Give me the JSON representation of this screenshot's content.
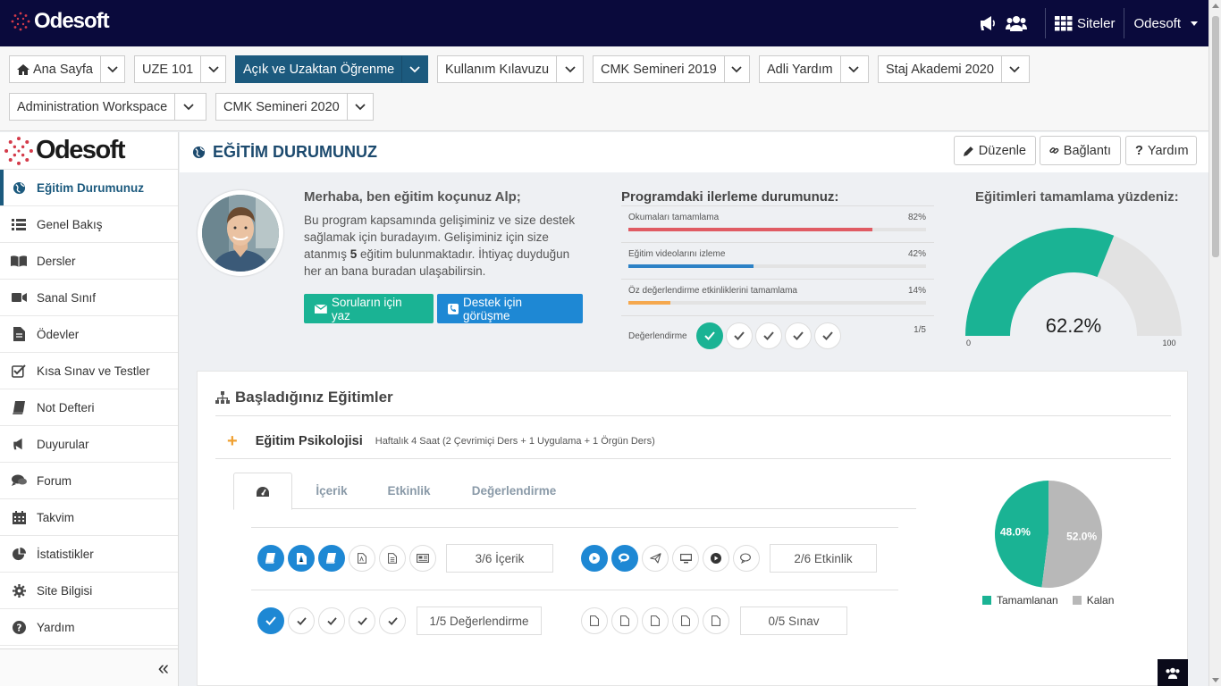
{
  "topbar": {
    "logo_text": "Odesoft",
    "sites_label": "Siteler",
    "user_label": "Odesoft"
  },
  "course_tabs": [
    {
      "label": "Ana Sayfa",
      "active": false
    },
    {
      "label": "UZE 101",
      "active": false
    },
    {
      "label": "Açık ve Uzaktan Öğrenme",
      "active": true
    },
    {
      "label": "Kullanım Kılavuzu",
      "active": false
    },
    {
      "label": "CMK Semineri 2019",
      "active": false
    },
    {
      "label": "Adli Yardım",
      "active": false
    },
    {
      "label": "Staj Akademi 2020",
      "active": false
    },
    {
      "label": "Administration Workspace",
      "active": false
    },
    {
      "label": "CMK Semineri 2020",
      "active": false
    }
  ],
  "sidebar": {
    "logo_text": "Odesoft",
    "items": [
      {
        "label": "Eğitim Durumunuz",
        "icon": "globe-icon"
      },
      {
        "label": "Genel Bakış",
        "icon": "list-icon"
      },
      {
        "label": "Dersler",
        "icon": "book-open-icon"
      },
      {
        "label": "Sanal Sınıf",
        "icon": "video-icon"
      },
      {
        "label": "Ödevler",
        "icon": "file-icon"
      },
      {
        "label": "Kısa Sınav ve Testler",
        "icon": "check-square-icon"
      },
      {
        "label": "Not Defteri",
        "icon": "notebook-icon"
      },
      {
        "label": "Duyurular",
        "icon": "bullhorn-icon"
      },
      {
        "label": "Forum",
        "icon": "comments-icon"
      },
      {
        "label": "Takvim",
        "icon": "calendar-icon"
      },
      {
        "label": "İstatistikler",
        "icon": "pie-chart-icon"
      },
      {
        "label": "Site Bilgisi",
        "icon": "gear-icon"
      },
      {
        "label": "Yardım",
        "icon": "question-circle-icon"
      }
    ],
    "collapse_glyph": "«"
  },
  "page": {
    "title": "EĞİTİM DURUMUNUZ",
    "buttons": {
      "edit": "Düzenle",
      "link": "Bağlantı",
      "help": "Yardım"
    }
  },
  "coach": {
    "title": "Merhaba, ben eğitim koçunuz Alp;",
    "text_before": "Bu program kapsamında gelişiminiz ve size destek sağlamak için buradayım. Gelişiminiz için size atanmış ",
    "count": "5",
    "text_after": " eğitim bulunmaktadır. İhtiyaç duyduğun her an bana buradan ulaşabilirsin.",
    "btn_questions": "Soruların için yaz",
    "btn_support": "Destek için görüşme"
  },
  "progress": {
    "title": "Programdaki ilerleme durumunuz:",
    "rows": [
      {
        "label": "Okumaları tamamlama",
        "value_text": "82%",
        "value": 82,
        "color": "#e05b63"
      },
      {
        "label": "Eğitim videolarını izleme",
        "value_text": "42%",
        "value": 42,
        "color": "#2d82c6"
      },
      {
        "label": "Öz değerlendirme etkinliklerini tamamlama",
        "value_text": "14%",
        "value": 14,
        "color": "#f5a84e"
      }
    ],
    "evaluation": {
      "label": "Değerlendirme",
      "value_text": "1/5",
      "done": 1,
      "total": 5
    }
  },
  "gauge": {
    "title": "Eğitimleri tamamlama yüzdeniz:",
    "value": 62.2,
    "value_text": "62.2%",
    "min_label": "0",
    "max_label": "100",
    "color": "#1ab394",
    "rest_color": "#e2e2e2"
  },
  "started": {
    "title": "Başladığınız Eğitimler",
    "course": {
      "name": "Eğitim Psikolojisi",
      "desc": "Haftalık 4 Saat (2 Çevrimiçi Ders + 1 Uygulama + 1 Örgün Ders)"
    },
    "tabs": [
      "İçerik",
      "Etkinlik",
      "Değerlendirme"
    ],
    "content_count": "3/6 İçerik",
    "activity_count": "2/6 Etkinlik",
    "evaluation_count": "1/5 Değerlendirme",
    "exam_count": "0/5 Sınav"
  },
  "pie": {
    "completed_label": "Tamamlanan",
    "remaining_label": "Kalan",
    "completed_value": 48.0,
    "remaining_value": 52.0,
    "completed_text": "48.0%",
    "remaining_text": "52.0%",
    "completed_color": "#1ab394",
    "remaining_color": "#b8b8b8"
  }
}
